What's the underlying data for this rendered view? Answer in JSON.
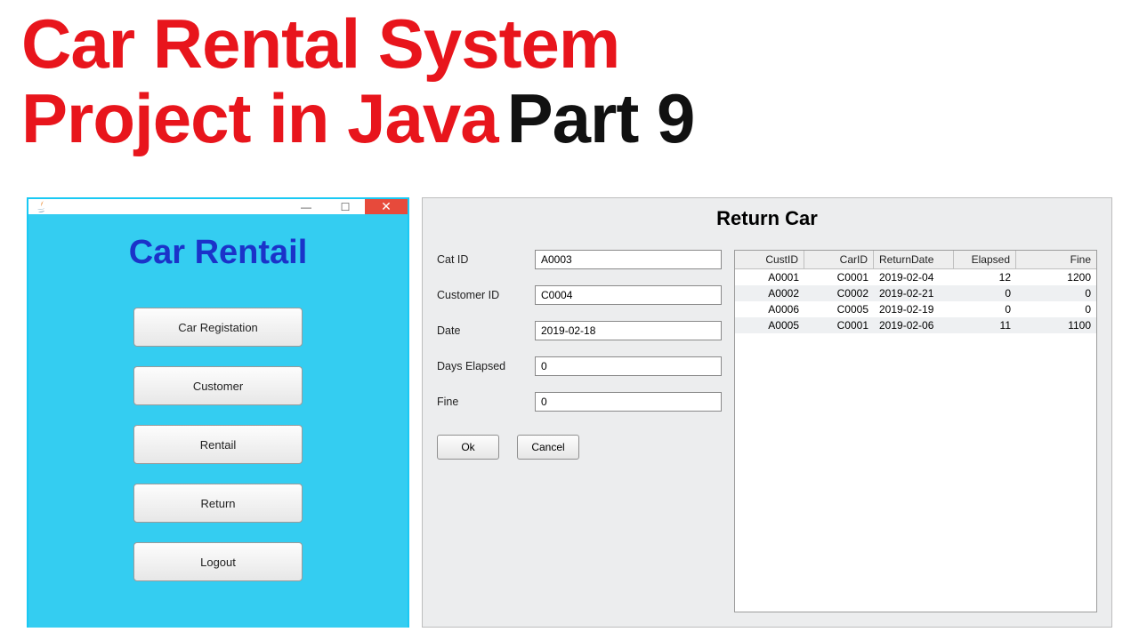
{
  "headline": {
    "line1": "Car Rental System",
    "line2_red": "Project in Java",
    "line2_black": "Part 9"
  },
  "menu_window": {
    "title": "Car Rentail",
    "buttons": [
      "Car Registation",
      "Customer",
      "Rentail",
      "Return",
      "Logout"
    ]
  },
  "return_panel": {
    "title": "Return Car",
    "form": {
      "labels": {
        "cat_id": "Cat ID",
        "customer_id": "Customer ID",
        "date": "Date",
        "days_elapsed": "Days Elapsed",
        "fine": "Fine"
      },
      "values": {
        "cat_id": "A0003",
        "customer_id": "C0004",
        "date": "2019-02-18",
        "days_elapsed": "0",
        "fine": "0"
      },
      "ok_label": "Ok",
      "cancel_label": "Cancel"
    },
    "table": {
      "headers": [
        "CustID",
        "CarID",
        "ReturnDate",
        "Elapsed",
        "Fine"
      ],
      "rows": [
        {
          "cust": "A0001",
          "car": "C0001",
          "date": "2019-02-04",
          "elapsed": "12",
          "fine": "1200"
        },
        {
          "cust": "A0002",
          "car": "C0002",
          "date": "2019-02-21",
          "elapsed": "0",
          "fine": "0"
        },
        {
          "cust": "A0006",
          "car": "C0005",
          "date": "2019-02-19",
          "elapsed": "0",
          "fine": "0"
        },
        {
          "cust": "A0005",
          "car": "C0001",
          "date": "2019-02-06",
          "elapsed": "11",
          "fine": "1100"
        }
      ]
    }
  }
}
